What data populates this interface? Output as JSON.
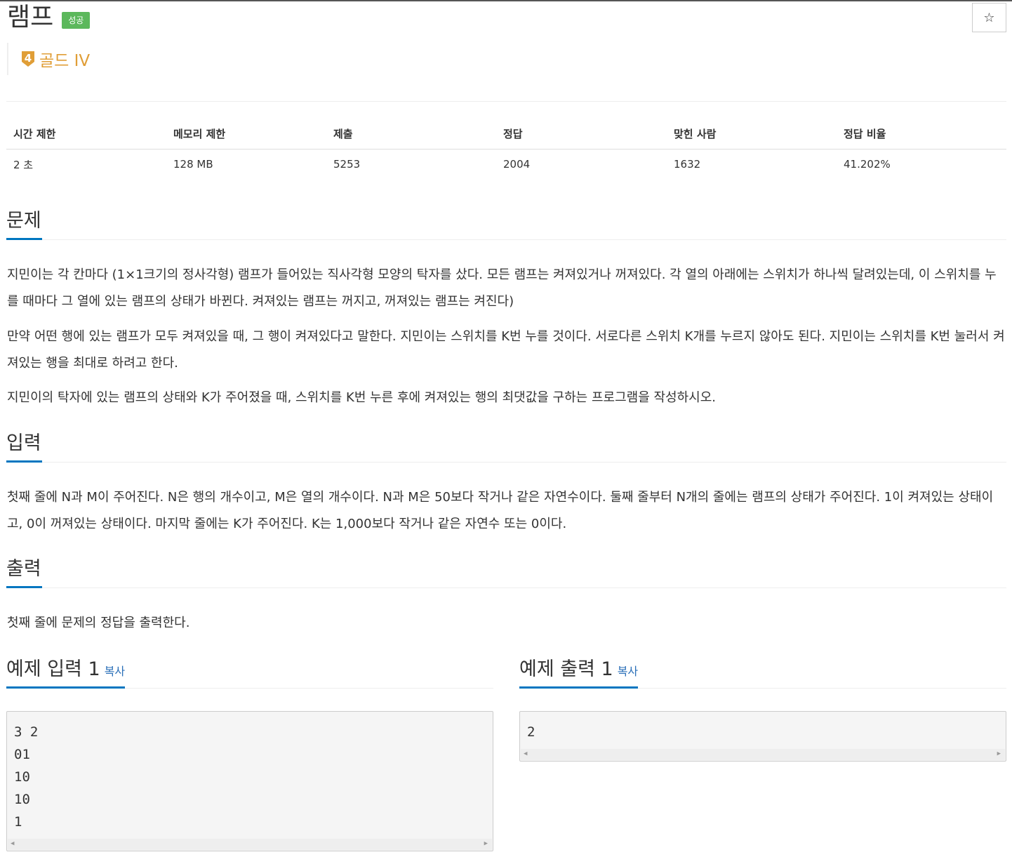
{
  "problem": {
    "title": "램프",
    "status_badge": "성공",
    "tier_number": "4",
    "tier_label": "골드 IV",
    "star_glyph": "☆"
  },
  "info": {
    "headers": [
      "시간 제한",
      "메모리 제한",
      "제출",
      "정답",
      "맞힌 사람",
      "정답 비율"
    ],
    "values": [
      "2 초",
      "128 MB",
      "5253",
      "2004",
      "1632",
      "41.202%"
    ]
  },
  "description": {
    "heading": "문제",
    "paragraphs": [
      "지민이는 각 칸마다 (1×1크기의 정사각형) 램프가 들어있는 직사각형 모양의 탁자를 샀다. 모든 램프는 켜져있거나 꺼져있다. 각 열의 아래에는 스위치가 하나씩 달려있는데, 이 스위치를 누를 때마다 그 열에 있는 램프의 상태가 바뀐다. 켜져있는 램프는 꺼지고, 꺼져있는 램프는 켜진다)",
      "만약 어떤 행에 있는 램프가 모두 켜져있을 때, 그 행이 켜져있다고 말한다. 지민이는 스위치를 K번 누를 것이다. 서로다른 스위치 K개를 누르지 않아도 된다. 지민이는 스위치를 K번 눌러서 켜져있는 행을 최대로 하려고 한다.",
      "지민이의 탁자에 있는 램프의 상태와 K가 주어졌을 때, 스위치를 K번 누른 후에 켜져있는 행의 최댓값을 구하는 프로그램을 작성하시오."
    ]
  },
  "input": {
    "heading": "입력",
    "text": "첫째 줄에 N과 M이 주어진다. N은 행의 개수이고, M은 열의 개수이다. N과 M은 50보다 작거나 같은 자연수이다. 둘째 줄부터 N개의 줄에는 램프의 상태가 주어진다. 1이 켜져있는 상태이고, 0이 꺼져있는 상태이다. 마지막 줄에는 K가 주어진다. K는 1,000보다 작거나 같은 자연수 또는 0이다."
  },
  "output": {
    "heading": "출력",
    "text": "첫째 줄에 문제의 정답을 출력한다."
  },
  "samples": {
    "input_heading": "예제 입력 1",
    "output_heading": "예제 출력 1",
    "copy_label": "복사",
    "input_lines": [
      "3 2",
      "01",
      "10",
      "10",
      "1"
    ],
    "output_lines": [
      "2"
    ]
  },
  "colors": {
    "badge_green": "#5cb85c",
    "gold_tier": "#e09e37",
    "heading_underline": "#0076c0",
    "copy_link": "#2a6fb8"
  }
}
